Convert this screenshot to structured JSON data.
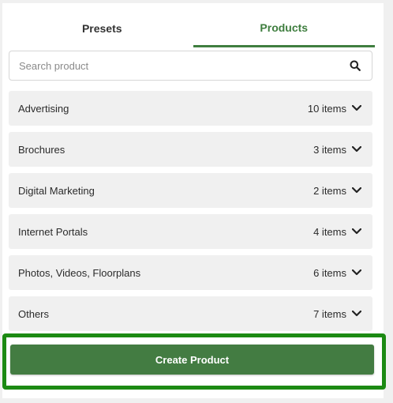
{
  "tabs": [
    {
      "label": "Presets",
      "active": false
    },
    {
      "label": "Products",
      "active": true
    }
  ],
  "search": {
    "placeholder": "Search product",
    "value": "",
    "icon": "search-icon"
  },
  "categories": [
    {
      "label": "Advertising",
      "count": "10 items"
    },
    {
      "label": "Brochures",
      "count": "3 items"
    },
    {
      "label": "Digital Marketing",
      "count": "2 items"
    },
    {
      "label": "Internet Portals",
      "count": "4 items"
    },
    {
      "label": "Photos, Videos, Floorplans",
      "count": "6 items"
    },
    {
      "label": "Others",
      "count": "7 items"
    }
  ],
  "actions": {
    "create_label": "Create Product"
  },
  "colors": {
    "accent": "#3f7e3f",
    "button": "#437c42",
    "highlight": "#1c8a13",
    "row_bg": "#f0f0f0"
  }
}
